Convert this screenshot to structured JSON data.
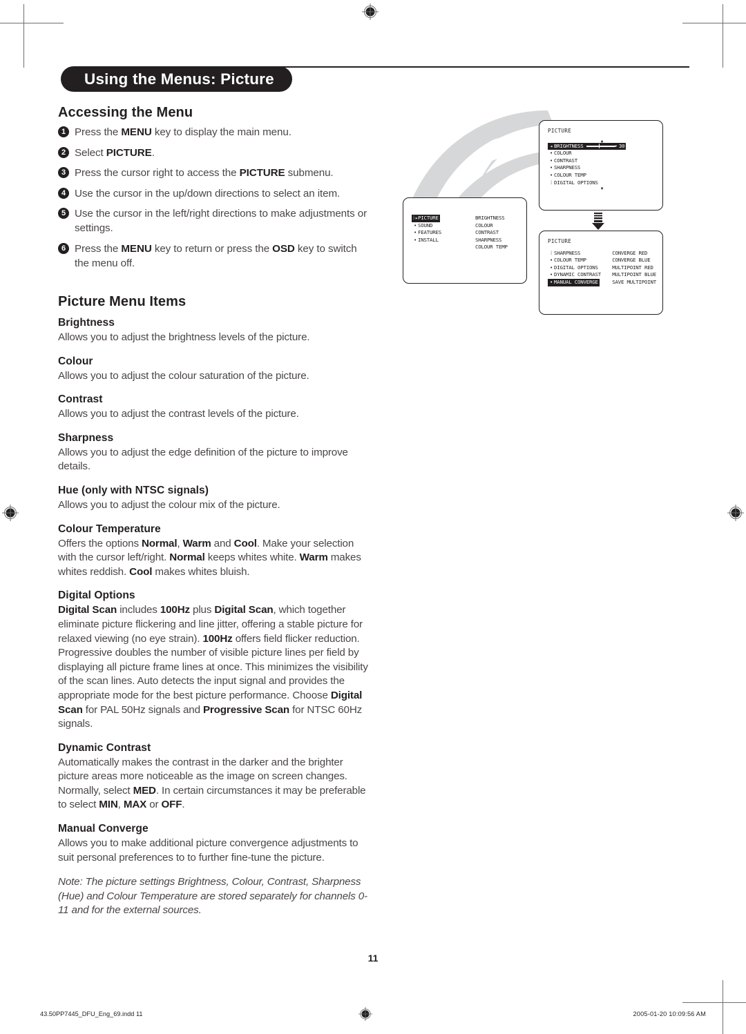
{
  "document": {
    "page_title": "Using the Menus: Picture",
    "page_number": "11"
  },
  "accessing": {
    "heading": "Accessing the Menu",
    "steps": [
      {
        "num": "1",
        "html": "Press the <b>MENU</b> key to display the main menu."
      },
      {
        "num": "2",
        "html": "Select <b>PICTURE</b>."
      },
      {
        "num": "3",
        "html": "Press the cursor right to access the <b>PICTURE</b> submenu."
      },
      {
        "num": "4",
        "html": "Use the cursor in the up/down directions to select an item."
      },
      {
        "num": "5",
        "html": "Use the cursor in the left/right directions to make adjustments or settings."
      },
      {
        "num": "6",
        "html": "Press the <b>MENU</b> key to return or press the <b>OSD</b> key to switch the menu off."
      }
    ]
  },
  "menu_items": {
    "heading": "Picture Menu Items",
    "definitions": [
      {
        "term": "Brightness",
        "html": "Allows you to adjust the brightness levels of the picture."
      },
      {
        "term": "Colour",
        "html": "Allows you to adjust the colour saturation of the picture."
      },
      {
        "term": "Contrast",
        "html": "Allows you to adjust the contrast levels of the picture."
      },
      {
        "term": "Sharpness",
        "html": "Allows you to adjust the edge definition of the picture to improve details."
      },
      {
        "term": "Hue (only with NTSC signals)",
        "html": "Allows you to adjust the colour mix of the picture."
      },
      {
        "term": "Colour Temperature",
        "html": "Offers the options <b>Normal</b>, <b>Warm</b> and <b>Cool</b>. Make your selection with the cursor left/right. <b>Normal</b> keeps whites white. <b>Warm</b> makes whites reddish. <b>Cool</b> makes whites bluish."
      },
      {
        "term": "Digital Options",
        "html": "<b>Digital Scan</b> includes <b>100Hz</b> plus <b>Digital Scan</b>, which together eliminate picture flickering and line jitter, offering a stable picture for relaxed viewing (no eye strain). <b>100Hz</b> offers field flicker reduction. Progressive doubles the number of visible picture lines per field by displaying all picture frame lines at once. This minimizes the visibility of the scan lines. Auto detects the input signal and provides the appropriate mode for the best picture performance. Choose <b>Digital Scan</b> for PAL 50Hz signals and <b>Progressive Scan</b> for NTSC 60Hz signals."
      },
      {
        "term": "Dynamic Contrast",
        "html": "Automatically makes the contrast in the darker and the brighter picture areas more noticeable as the image on screen changes. Normally, select <b>MED</b>. In certain circumstances it may be preferable to select <b>MIN</b>, <b>MAX</b> or <b>OFF</b>."
      },
      {
        "term": "Manual Converge",
        "html": "Allows you to make additional picture convergence adjustments to suit personal preferences to to further fine-tune the picture."
      }
    ],
    "note": "Note: The picture settings Brightness, Colour, Contrast, Sharpness (Hue) and Colour Temperature are stored separately for channels 0-11 and for the external sources."
  },
  "osd": {
    "main_menu": {
      "left_column": [
        {
          "bullet": "⁞▸",
          "label": "PICTURE",
          "highlight": true
        },
        {
          "bullet": "•",
          "label": "SOUND",
          "highlight": false
        },
        {
          "bullet": "•",
          "label": "FEATURES",
          "highlight": false
        },
        {
          "bullet": "•",
          "label": "INSTALL",
          "highlight": false
        }
      ],
      "right_column": [
        "BRIGHTNESS",
        "COLOUR",
        "CONTRAST",
        "SHARPNESS",
        "COLOUR TEMP"
      ]
    },
    "picture_submenu": {
      "title": "PICTURE",
      "up_mark": "▲",
      "down_mark": "▼",
      "rows": [
        {
          "bullet": "◂",
          "label": "BRIGHTNESS",
          "highlight": true,
          "slider": true,
          "value": "30"
        },
        {
          "bullet": "•",
          "label": "COLOUR",
          "highlight": false
        },
        {
          "bullet": "•",
          "label": "CONTRAST",
          "highlight": false
        },
        {
          "bullet": "•",
          "label": "SHARPNESS",
          "highlight": false
        },
        {
          "bullet": "•",
          "label": "COLOUR TEMP",
          "highlight": false
        },
        {
          "bullet": "⁞",
          "label": "DIGITAL OPTIONS",
          "highlight": false
        }
      ]
    },
    "manual_converge": {
      "title": "PICTURE",
      "left_column": [
        {
          "bullet": "⁞",
          "label": "SHARPNESS",
          "highlight": false
        },
        {
          "bullet": "•",
          "label": "COLOUR TEMP",
          "highlight": false
        },
        {
          "bullet": "•",
          "label": "DIGITAL OPTIONS",
          "highlight": false
        },
        {
          "bullet": "•",
          "label": "DYNAMIC CONTRAST",
          "highlight": false
        },
        {
          "bullet": "•",
          "label": "MANUAL CONVERGE",
          "highlight": true
        }
      ],
      "right_column": [
        "CONVERGE RED",
        "CONVERGE BLUE",
        "MULTIPOINT RED",
        "MULTIPOINT BLUE",
        "SAVE MULTIPOINT"
      ]
    }
  },
  "footer": {
    "file": "43.50PP7445_DFU_Eng_69.indd   11",
    "timestamp": "2005-01-20   10:09:56 AM"
  }
}
